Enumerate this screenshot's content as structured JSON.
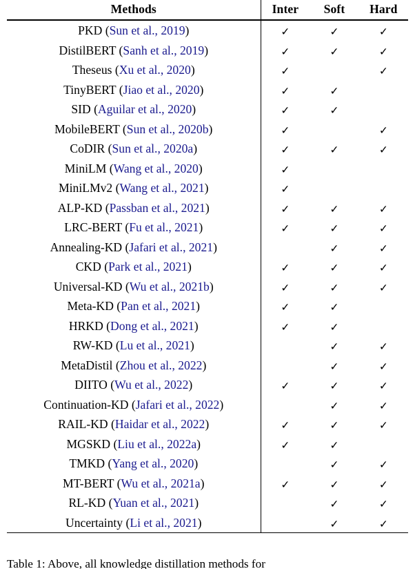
{
  "colors": {
    "text": "#000000",
    "citation_link": "#1a1a8e",
    "rule": "#000000",
    "background": "#ffffff"
  },
  "table": {
    "columns": [
      "Methods",
      "Inter",
      "Soft",
      "Hard"
    ],
    "check_glyph": "✓",
    "rows": [
      {
        "name": "PKD",
        "citation": "Sun et al., 2019",
        "inter": true,
        "soft": true,
        "hard": true
      },
      {
        "name": "DistilBERT",
        "citation": "Sanh et al., 2019",
        "inter": true,
        "soft": true,
        "hard": true
      },
      {
        "name": "Theseus",
        "citation": "Xu et al., 2020",
        "inter": true,
        "soft": false,
        "hard": true
      },
      {
        "name": "TinyBERT",
        "citation": "Jiao et al., 2020",
        "inter": true,
        "soft": true,
        "hard": false
      },
      {
        "name": "SID",
        "citation": "Aguilar et al., 2020",
        "inter": true,
        "soft": true,
        "hard": false
      },
      {
        "name": "MobileBERT",
        "citation": "Sun et al., 2020b",
        "inter": true,
        "soft": false,
        "hard": true
      },
      {
        "name": "CoDIR",
        "citation": "Sun et al., 2020a",
        "inter": true,
        "soft": true,
        "hard": true
      },
      {
        "name": "MiniLM",
        "citation": "Wang et al., 2020",
        "inter": true,
        "soft": false,
        "hard": false
      },
      {
        "name": "MiniLMv2",
        "citation": "Wang et al., 2021",
        "inter": true,
        "soft": false,
        "hard": false
      },
      {
        "name": "ALP-KD",
        "citation": "Passban et al., 2021",
        "inter": true,
        "soft": true,
        "hard": true
      },
      {
        "name": "LRC-BERT",
        "citation": "Fu et al., 2021",
        "inter": true,
        "soft": true,
        "hard": true
      },
      {
        "name": "Annealing-KD",
        "citation": "Jafari et al., 2021",
        "inter": false,
        "soft": true,
        "hard": true
      },
      {
        "name": "CKD",
        "citation": "Park et al., 2021",
        "inter": true,
        "soft": true,
        "hard": true
      },
      {
        "name": "Universal-KD",
        "citation": "Wu et al., 2021b",
        "inter": true,
        "soft": true,
        "hard": true
      },
      {
        "name": "Meta-KD",
        "citation": "Pan et al., 2021",
        "inter": true,
        "soft": true,
        "hard": false
      },
      {
        "name": "HRKD",
        "citation": "Dong et al., 2021",
        "inter": true,
        "soft": true,
        "hard": false
      },
      {
        "name": "RW-KD",
        "citation": "Lu et al., 2021",
        "inter": false,
        "soft": true,
        "hard": true
      },
      {
        "name": "MetaDistil",
        "citation": "Zhou et al., 2022",
        "inter": false,
        "soft": true,
        "hard": true
      },
      {
        "name": "DIITO",
        "citation": "Wu et al., 2022",
        "inter": true,
        "soft": true,
        "hard": true
      },
      {
        "name": "Continuation-KD",
        "citation": "Jafari et al., 2022",
        "inter": false,
        "soft": true,
        "hard": true
      },
      {
        "name": "RAIL-KD",
        "citation": "Haidar et al., 2022",
        "inter": true,
        "soft": true,
        "hard": true
      },
      {
        "name": "MGSKD",
        "citation": "Liu et al., 2022a",
        "inter": true,
        "soft": true,
        "hard": false
      },
      {
        "name": "TMKD",
        "citation": "Yang et al., 2020",
        "inter": false,
        "soft": true,
        "hard": true
      },
      {
        "name": "MT-BERT",
        "citation": "Wu et al., 2021a",
        "inter": true,
        "soft": true,
        "hard": true
      },
      {
        "name": "RL-KD",
        "citation": "Yuan et al., 2021",
        "inter": false,
        "soft": true,
        "hard": true
      },
      {
        "name": "Uncertainty",
        "citation": "Li et al., 2021",
        "inter": false,
        "soft": true,
        "hard": true
      }
    ]
  },
  "caption": {
    "text": "Table 1: Above, all knowledge distillation methods for"
  }
}
